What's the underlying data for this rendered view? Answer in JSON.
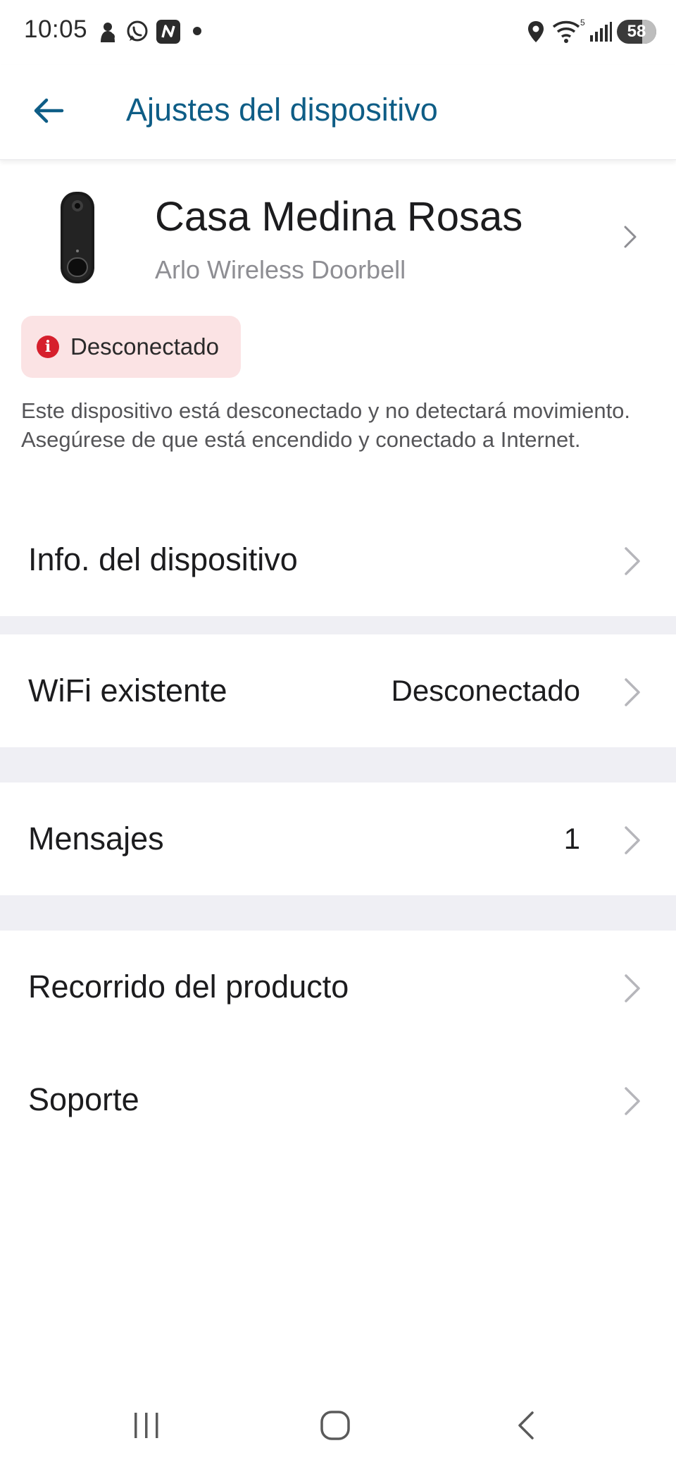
{
  "status_bar": {
    "time": "10:05",
    "battery": "58",
    "icons": [
      "hand-icon",
      "whatsapp-icon",
      "app-n-icon",
      "dot-icon",
      "location-icon",
      "wifi-icon",
      "signal-icon",
      "battery-icon"
    ]
  },
  "app_bar": {
    "title": "Ajustes del dispositivo",
    "back_icon": "arrow-left-icon",
    "accent_color": "#0e5d86"
  },
  "device": {
    "name": "Casa Medina Rosas",
    "model": "Arlo Wireless Doorbell",
    "image": "doorbell-device-image"
  },
  "status": {
    "label": "Desconectado",
    "icon_glyph": "i",
    "badge_color": "#fbe3e4",
    "icon_color": "#d61f2c"
  },
  "warning_message": "Este dispositivo está desconectado y no detectará movimiento. Asegúrese de que está encendido y conectado a Internet.",
  "menu": {
    "device_info": {
      "label": "Info. del dispositivo"
    },
    "wifi": {
      "label": "WiFi existente",
      "value": "Desconectado"
    },
    "messages": {
      "label": "Mensajes",
      "value": "1"
    },
    "product_tour": {
      "label": "Recorrido del producto"
    },
    "support": {
      "label": "Soporte"
    }
  },
  "nav_bar": {
    "icons": [
      "recent-apps-icon",
      "home-icon",
      "back-icon"
    ]
  }
}
